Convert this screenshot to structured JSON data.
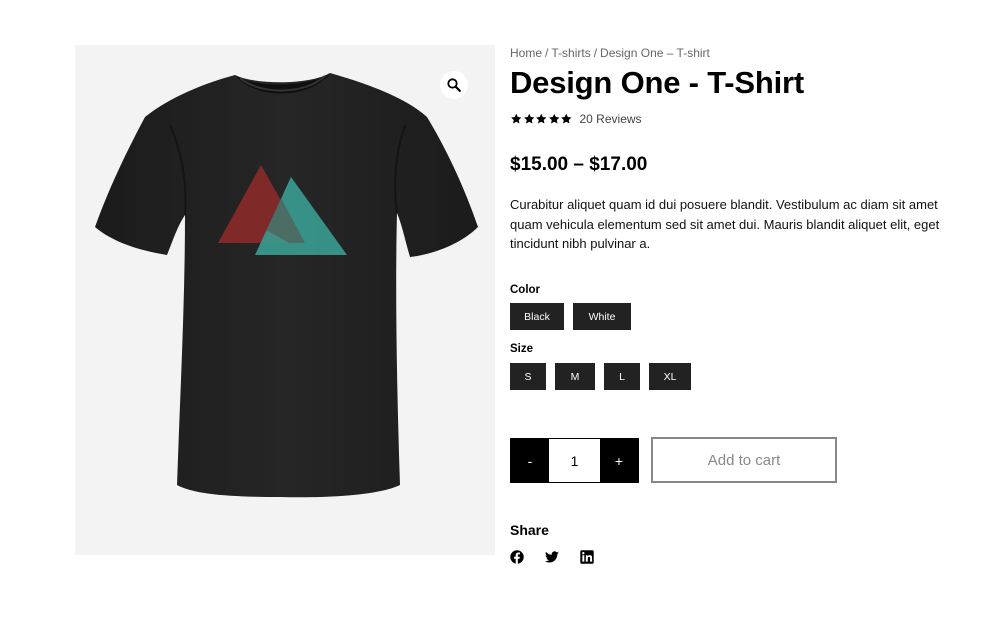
{
  "gallery": {
    "zoom_icon": "magnifier-icon",
    "image": "black-tshirt-with-red-and-teal-triangles"
  },
  "breadcrumb": {
    "items": [
      "Home",
      "T-shirts",
      "Design One – T-shirt"
    ],
    "separator": "/"
  },
  "product": {
    "title": "Design One - T-Shirt",
    "rating": 5,
    "rating_max": 5,
    "reviews_label": "20 Reviews",
    "price": "$15.00 – $17.00",
    "description": "Curabitur aliquet quam id dui posuere blandit. Vestibulum ac diam sit amet quam vehicula elementum sed sit amet dui. Mauris blandit aliquet elit, eget tincidunt nibh pulvinar a."
  },
  "attributes": {
    "color": {
      "label": "Color",
      "options": [
        "Black",
        "White"
      ]
    },
    "size": {
      "label": "Size",
      "options": [
        "S",
        "M",
        "L",
        "XL"
      ]
    }
  },
  "cart": {
    "minus_label": "-",
    "plus_label": "+",
    "quantity": "1",
    "add_label": "Add to cart"
  },
  "share": {
    "title": "Share",
    "icons": [
      "facebook-icon",
      "twitter-icon",
      "linkedin-icon"
    ]
  },
  "colors": {
    "swatch_bg": "#222222",
    "gallery_bg": "#f3f3f3",
    "triangle_red": "#8a2a2a",
    "triangle_teal": "#3a9a8e"
  }
}
